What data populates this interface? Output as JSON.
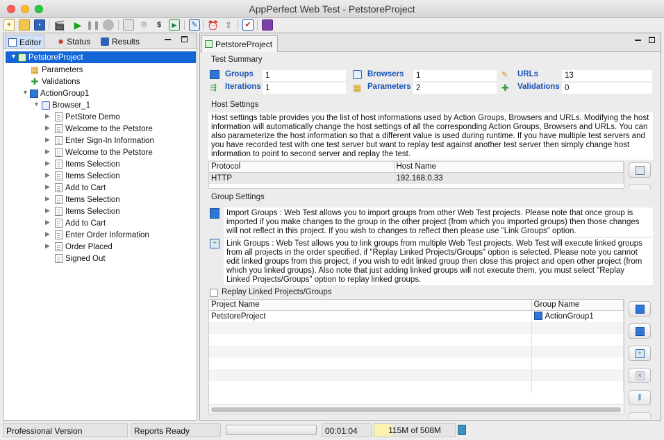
{
  "window": {
    "title": "AppPerfect Web Test - PetstoreProject"
  },
  "left_tabs": [
    {
      "label": "Editor",
      "icon": "editor-icon"
    },
    {
      "label": "Status",
      "icon": "status-icon"
    },
    {
      "label": "Results",
      "icon": "results-icon"
    }
  ],
  "tree": {
    "root": "PetstoreProject",
    "parameters": "Parameters",
    "validations": "Validations",
    "action_group": "ActionGroup1",
    "browser": "Browser_1",
    "pages": [
      "PetStore Demo",
      "Welcome to the Petstore",
      "Enter Sign-In Information",
      "Welcome to the Petstore",
      "Items Selection",
      "Items Selection",
      "Add to Cart",
      "Items Selection",
      "Items Selection",
      "Add to Cart",
      "Enter Order Information",
      "Order Placed",
      "Signed Out"
    ]
  },
  "editor_tab": {
    "label": "PetstoreProject"
  },
  "test_summary": {
    "heading": "Test Summary",
    "groups_label": "Groups",
    "groups_value": "1",
    "browsers_label": "Browsers",
    "browsers_value": "1",
    "urls_label": "URLs",
    "urls_value": "13",
    "iterations_label": "Iterations",
    "iterations_value": "1",
    "parameters_label": "Parameters",
    "parameters_value": "2",
    "validations_label": "Validations",
    "validations_value": "0"
  },
  "host_settings": {
    "heading": "Host Settings",
    "description": "Host settings table provides you the list of host informations used by Action Groups, Browsers and URLs. Modifying the host information will automatically change the host settings of all the corresponding Action Groups, Browsers and URLs. You can also parameterize the host information so that a different value is used during runtime. If you have multiple test servers and you have recorded test with one test server but want to replay test against another test server then simply change host information to point to second server and replay the test.",
    "col_protocol": "Protocol",
    "col_host": "Host Name",
    "row_protocol": "HTTP",
    "row_host": "192.168.0.33"
  },
  "group_settings": {
    "heading": "Group Settings",
    "import_text": "Import Groups : Web Test allows you to import groups from other Web Test projects. Please note that once group is imported if you make changes to the group in the other project (from which you imported groups) then those changes will not reflect in this project. If you wish to changes to reflect then please use \"Link Groups\" option.",
    "link_text": "Link Groups : Web Test allows you to link groups from multiple Web Test projects. Web Test will execute linked groups from all projects in the order specified, if \"Replay Linked Projects/Groups\" option is selected. Please note you cannot edit linked groups from this project, if you wish to edit linked group then close this project and open other project (from which you linked groups). Also note that just adding linked groups will not execute them, you must select \"Replay Linked Projects/Groups\" option to replay linked groups.",
    "replay_label": "Replay Linked Projects/Groups",
    "replay_checked": false,
    "col_project": "Project Name",
    "col_group": "Group Name",
    "row_project": "PetstoreProject",
    "row_group": "ActionGroup1"
  },
  "status_bar": {
    "edition": "Professional Version",
    "reports": "Reports Ready",
    "elapsed": "00:01:04",
    "memory": "115M of 508M",
    "memory_fraction": 0.226
  },
  "colors": {
    "selection": "#1466d6",
    "link_label": "#1a55b5",
    "memory_fill": "#fbf3b0"
  }
}
